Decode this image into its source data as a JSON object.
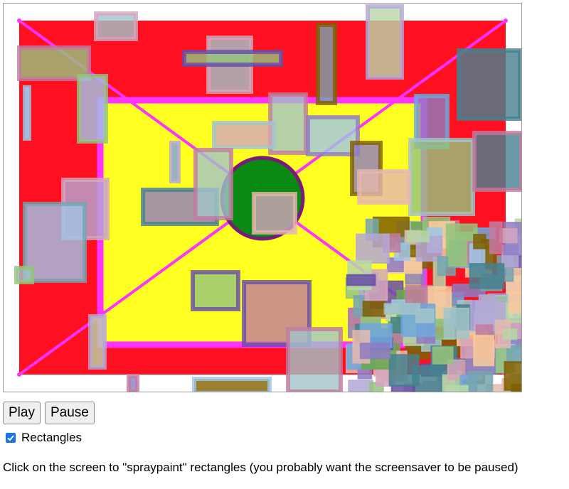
{
  "controls": {
    "play_label": "Play",
    "pause_label": "Pause"
  },
  "checkbox": {
    "label": "Rectangles",
    "checked": true
  },
  "instructions": "Click on the screen to \"spraypaint\" rectangles (you probably want the screensaver to be paused)",
  "colors": {
    "outer_fill": "#ff1020",
    "inner_fill": "#ffff22",
    "diagonal_lines": "#ff33ff",
    "center_circle": "#0a8a12",
    "circle_border": "#7a1a7a",
    "checkbox_accent": "#1a73e8"
  }
}
